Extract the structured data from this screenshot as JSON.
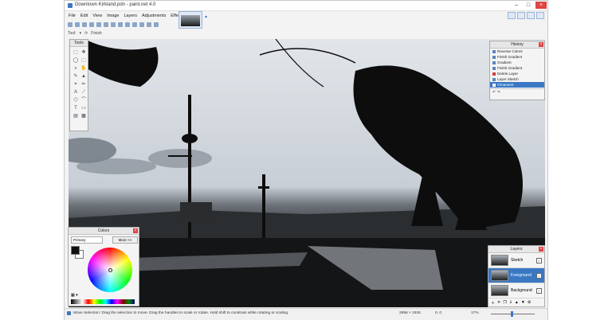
{
  "window": {
    "title": "Downtown Kirkland.pdn - paint.net 4.0",
    "minimize": "–",
    "maximize": "□",
    "close": "×"
  },
  "menu": [
    "File",
    "Edit",
    "View",
    "Image",
    "Layers",
    "Adjustments",
    "Effects"
  ],
  "toolbar2": {
    "tool_label": "Tool:",
    "finish_label": "Finish"
  },
  "tools_panel": {
    "title": "Tools",
    "tools": [
      "⬚",
      "✥",
      "◯",
      "⬚",
      "⌕",
      "✋",
      "✎",
      "▲",
      "⌖",
      "✏",
      "A",
      "⟋",
      "⬡",
      "⌒",
      "T",
      "▭",
      "▤",
      "▩"
    ]
  },
  "history_panel": {
    "title": "History",
    "items": [
      "Reverse Colors",
      "Finish Gradient",
      "Gradient",
      "Finish Gradient",
      "Delete Layer",
      "Layer Sketch",
      "Ornament"
    ],
    "selected_index": 6
  },
  "colors_panel": {
    "title": "Colors",
    "mode": "Primary",
    "more_label": "More >>",
    "primary": "#111111",
    "secondary": "#ffffff"
  },
  "layers_panel": {
    "title": "Layers",
    "layers": [
      "Sketch",
      "Foreground",
      "Background"
    ],
    "selected_index": 1
  },
  "status": {
    "hint": "Move Selection: Drag the selection to move. Drag the handles to scale or rotate. Hold shift to constrain while rotating or scaling.",
    "size": "2956 × 1934",
    "pos": "0, 0",
    "zoom": "17%"
  }
}
